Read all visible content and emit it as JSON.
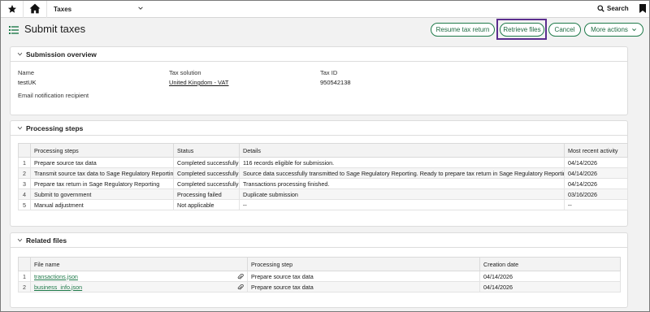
{
  "topbar": {
    "module": "Taxes",
    "search_label": "Search"
  },
  "header": {
    "title": "Submit taxes",
    "buttons": {
      "resume": "Resume tax return",
      "retrieve": "Retrieve files",
      "cancel": "Cancel",
      "more": "More actions"
    }
  },
  "overview": {
    "title": "Submission overview",
    "name_label": "Name",
    "name_value": "testUK",
    "solution_label": "Tax solution",
    "solution_value": "United Kingdom - VAT",
    "taxid_label": "Tax ID",
    "taxid_value": "950542138",
    "email_label": "Email notification recipient"
  },
  "steps": {
    "title": "Processing steps",
    "columns": [
      "Processing steps",
      "Status",
      "Details",
      "Most recent activity"
    ],
    "rows": [
      {
        "n": "1",
        "step": "Prepare source tax data",
        "status": "Completed successfully",
        "details": "116 records eligible for submission.",
        "date": "04/14/2026"
      },
      {
        "n": "2",
        "step": "Transmit source tax data to Sage Regulatory Reporting",
        "status": "Completed successfully",
        "details": "Source data successfully transmitted to Sage Regulatory Reporting. Ready to prepare tax return in Sage Regulatory Reporting.",
        "date": "04/14/2026"
      },
      {
        "n": "3",
        "step": "Prepare tax return in Sage Regulatory Reporting",
        "status": "Completed successfully",
        "details": "Transactions processing finished.",
        "date": "04/14/2026"
      },
      {
        "n": "4",
        "step": "Submit to government",
        "status": "Processing failed",
        "details": "Duplicate submission",
        "date": "03/16/2026"
      },
      {
        "n": "5",
        "step": "Manual adjustment",
        "status": "Not applicable",
        "details": "--",
        "date": "--"
      }
    ]
  },
  "files": {
    "title": "Related files",
    "columns": [
      "File name",
      "Processing step",
      "Creation date"
    ],
    "rows": [
      {
        "n": "1",
        "file": "transactions.json",
        "step": "Prepare source tax data",
        "date": "04/14/2026"
      },
      {
        "n": "2",
        "file": "business_info.json",
        "step": "Prepare source tax data",
        "date": "04/14/2026"
      }
    ]
  }
}
